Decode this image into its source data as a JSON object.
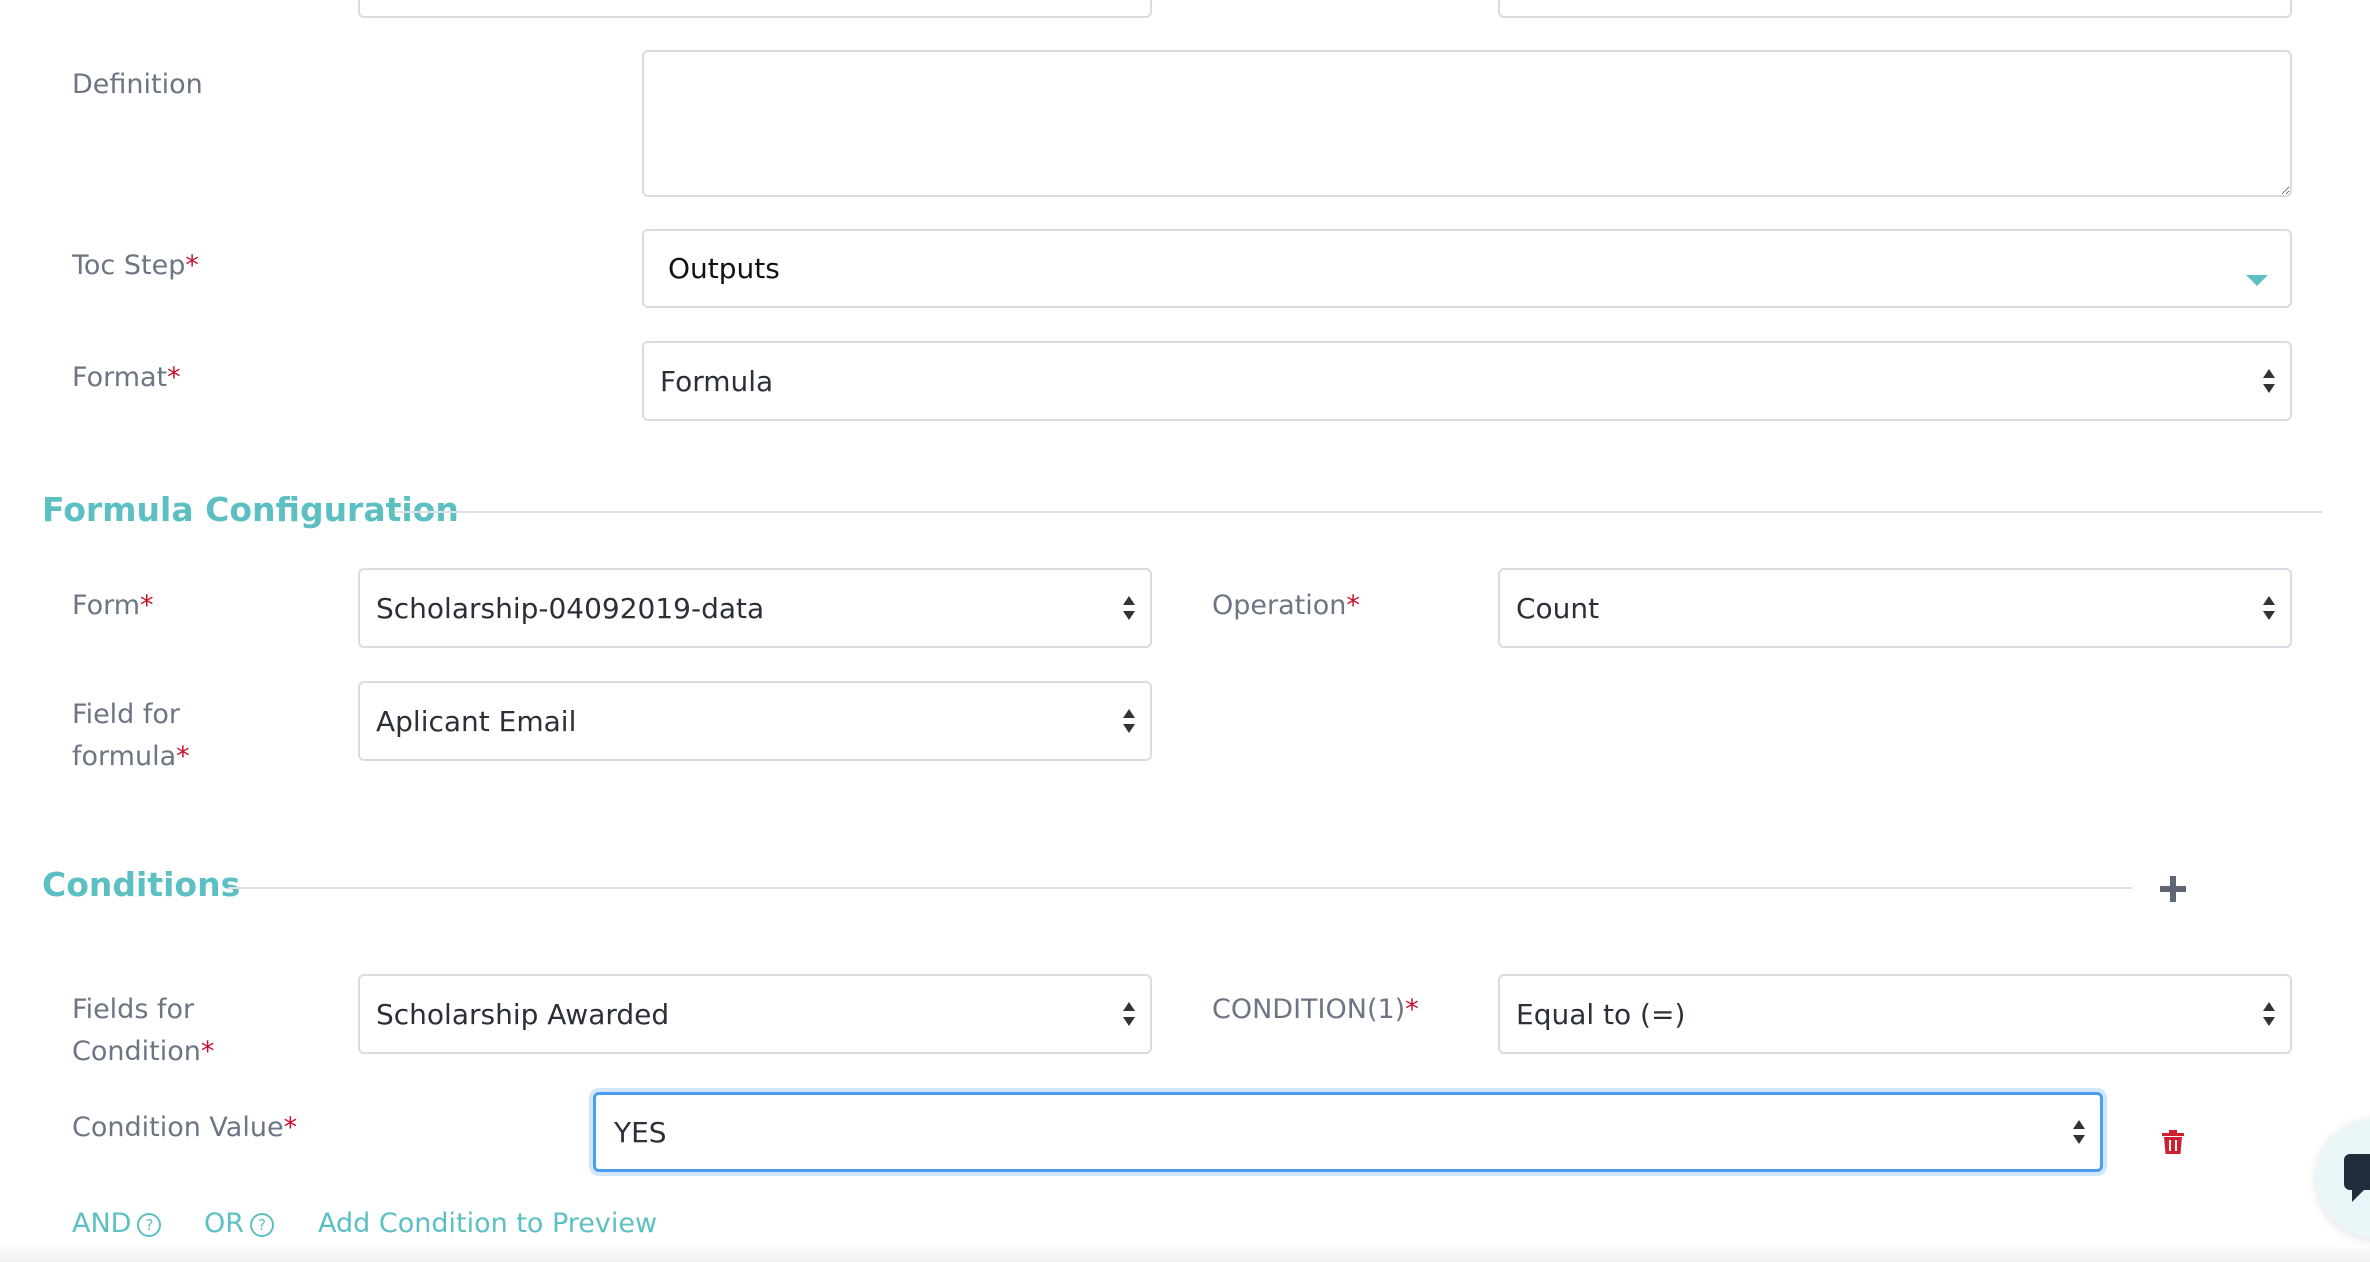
{
  "fields": {
    "definition_label": "Definition",
    "definition_value": "",
    "toc_step_label": "Toc Step",
    "toc_step_value": "Outputs",
    "format_label": "Format",
    "format_value": "Formula"
  },
  "required_mark": "*",
  "formula_configuration": {
    "title": "Formula Configuration",
    "form_label": "Form",
    "form_value": "Scholarship-04092019-data",
    "operation_label": "Operation",
    "operation_value": "Count",
    "field_for_formula_label_line1": "Field for",
    "field_for_formula_label_line2": "formula",
    "field_for_formula_value": "Aplicant Email"
  },
  "conditions": {
    "title": "Conditions",
    "add_icon": "plus-icon",
    "fields_label_line1": "Fields for",
    "fields_label_line2": "Condition",
    "fields_value": "Scholarship Awarded",
    "condition_label": "CONDITION(1)",
    "condition_value": "Equal to (=)",
    "value_label": "Condition Value",
    "value_value": "YES",
    "delete_icon": "trash-icon"
  },
  "actions": {
    "and_label": "AND",
    "or_label": "OR",
    "help_glyph": "?",
    "add_preview_label": "Add Condition to Preview"
  },
  "colors": {
    "accent": "#5cc0c3",
    "required": "#c8102e",
    "focus": "#4a9ef0"
  }
}
